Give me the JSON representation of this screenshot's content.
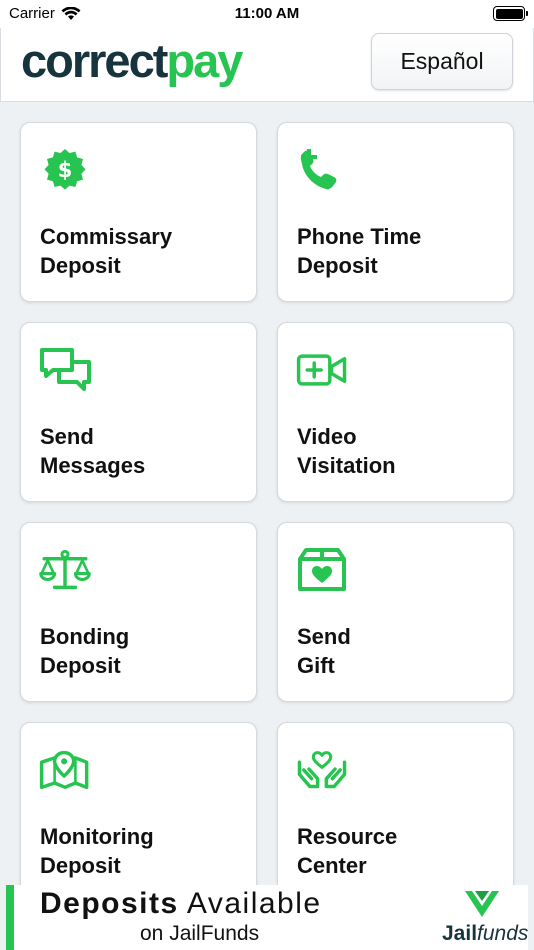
{
  "status_bar": {
    "carrier": "Carrier",
    "time": "11:00 AM"
  },
  "header": {
    "logo_part1": "correct",
    "logo_part2": "pay",
    "language_button": "Español"
  },
  "colors": {
    "brand_green": "#28c451",
    "brand_dark": "#17333d",
    "background": "#eef1f4"
  },
  "tiles": [
    {
      "label": "Commissary\nDeposit",
      "icon": "dollar-badge-icon"
    },
    {
      "label": "Phone Time\nDeposit",
      "icon": "phone-plus-icon"
    },
    {
      "label": "Send\nMessages",
      "icon": "chat-bubbles-icon"
    },
    {
      "label": "Video\nVisitation",
      "icon": "video-plus-icon"
    },
    {
      "label": "Bonding\nDeposit",
      "icon": "scales-icon"
    },
    {
      "label": "Send\nGift",
      "icon": "gift-box-heart-icon"
    },
    {
      "label": "Monitoring\nDeposit",
      "icon": "map-pin-icon"
    },
    {
      "label": "Resource\nCenter",
      "icon": "hands-heart-icon"
    }
  ],
  "banner": {
    "line1_strong": "Deposits",
    "line1_rest": "Available",
    "line2": "on JailFunds",
    "brand_part1": "Jail",
    "brand_part2": "funds"
  }
}
